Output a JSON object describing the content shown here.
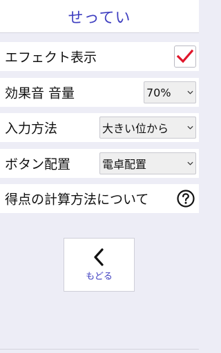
{
  "header": {
    "title": "せってい"
  },
  "settings": {
    "effect": {
      "label": "エフェクト表示",
      "checked": true
    },
    "volume": {
      "label": "効果音 音量",
      "value": "70%"
    },
    "input": {
      "label": "入力方法",
      "value": "大きい位から"
    },
    "buttons": {
      "label": "ボタン配置",
      "value": "電卓配置"
    },
    "help": {
      "label": "得点の計算方法について"
    }
  },
  "back": {
    "label": "もどる"
  },
  "colors": {
    "accent": "#3e3ec0",
    "check": "#e0162b",
    "background": "#ededf6"
  },
  "icons": {
    "check": "checkmark-icon",
    "chevron": "chevron-down-icon",
    "help": "question-circle-icon",
    "back": "chevron-left-icon"
  }
}
